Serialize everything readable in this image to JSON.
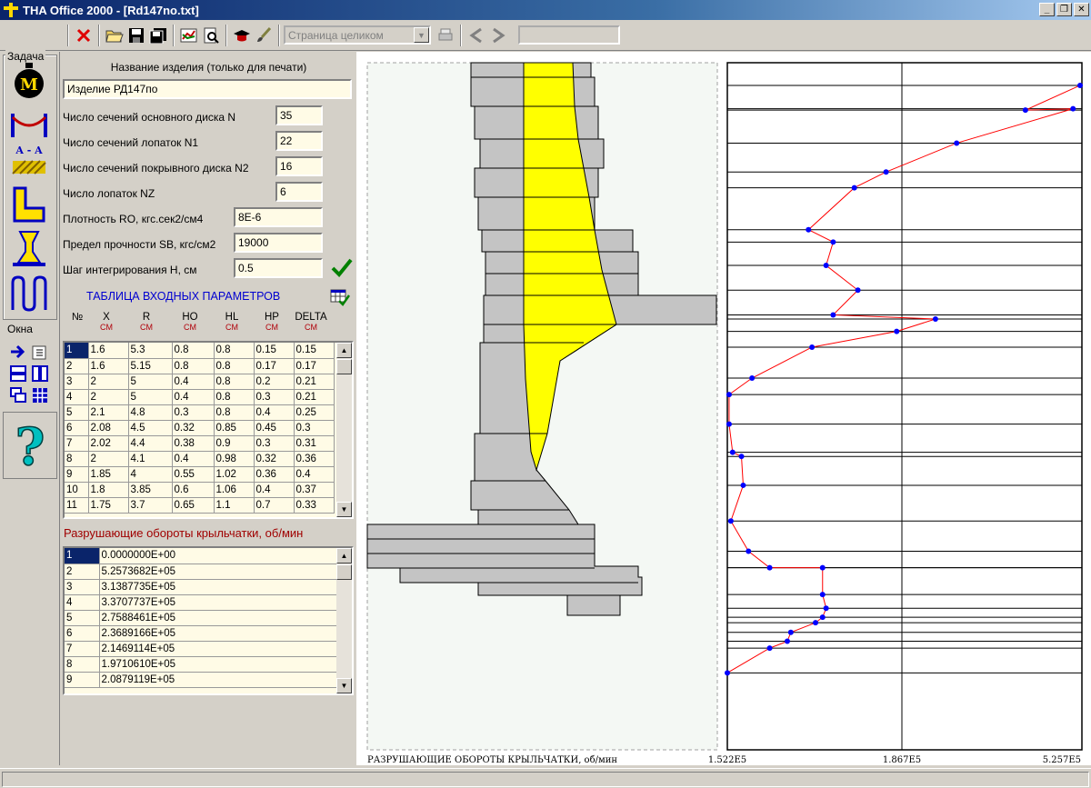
{
  "window": {
    "title": "THA Office 2000 - [Rd147no.txt]",
    "minimize_glyph": "_",
    "restore_glyph": "❐",
    "close_glyph": "✕"
  },
  "toolbar": {
    "page_mode": "Страница целиком"
  },
  "taskpanel": {
    "group_task": "Задача",
    "group_windows": "Окна",
    "section_label": "A - A",
    "mass_letter": "M",
    "help_glyph": "?"
  },
  "form": {
    "product_name_label": "Название изделия (только для печати)",
    "product_name_value": "Изделие РД147по",
    "fields": [
      {
        "label": "Число сечений основного диска  N",
        "value": "35"
      },
      {
        "label": "Число сечений лопаток  N1",
        "value": "22"
      },
      {
        "label": "Число сечений покрывного диска  N2",
        "value": "16"
      },
      {
        "label": "Число лопаток  NZ",
        "value": "6"
      },
      {
        "label": "Плотность  RO, кгс.сек2/см4",
        "value": "8E-6"
      },
      {
        "label": "Предел прочности SB,  кгс/см2",
        "value": "19000"
      },
      {
        "label": "Шаг интегрирования  H,  см",
        "value": "0.5"
      }
    ],
    "input_table_title": "ТАБЛИЦА  ВХОДНЫХ  ПАРАМЕТРОВ",
    "columns": [
      {
        "name": "№",
        "unit": ""
      },
      {
        "name": "X",
        "unit": "СМ"
      },
      {
        "name": "R",
        "unit": "СМ"
      },
      {
        "name": "HO",
        "unit": "СМ"
      },
      {
        "name": "HL",
        "unit": "СМ"
      },
      {
        "name": "HP",
        "unit": "СМ"
      },
      {
        "name": "DELTA",
        "unit": "СМ"
      }
    ],
    "rows": [
      [
        "1",
        "1.6",
        "5.3",
        "0.8",
        "0.8",
        "0.15",
        "0.15"
      ],
      [
        "2",
        "1.6",
        "5.15",
        "0.8",
        "0.8",
        "0.17",
        "0.17"
      ],
      [
        "3",
        "2",
        "5",
        "0.4",
        "0.8",
        "0.2",
        "0.21"
      ],
      [
        "4",
        "2",
        "5",
        "0.4",
        "0.8",
        "0.3",
        "0.21"
      ],
      [
        "5",
        "2.1",
        "4.8",
        "0.3",
        "0.8",
        "0.4",
        "0.25"
      ],
      [
        "6",
        "2.08",
        "4.5",
        "0.32",
        "0.85",
        "0.45",
        "0.3"
      ],
      [
        "7",
        "2.02",
        "4.4",
        "0.38",
        "0.9",
        "0.3",
        "0.31"
      ],
      [
        "8",
        "2",
        "4.1",
        "0.4",
        "0.98",
        "0.32",
        "0.36"
      ],
      [
        "9",
        "1.85",
        "4",
        "0.55",
        "1.02",
        "0.36",
        "0.4"
      ],
      [
        "10",
        "1.8",
        "3.85",
        "0.6",
        "1.06",
        "0.4",
        "0.37"
      ],
      [
        "11",
        "1.75",
        "3.7",
        "0.65",
        "1.1",
        "0.7",
        "0.33"
      ]
    ],
    "speed_title": "Разрушающие обороты крыльчатки,  об/мин",
    "speeds": [
      [
        "1",
        "0.0000000E+00"
      ],
      [
        "2",
        "5.2573682E+05"
      ],
      [
        "3",
        "3.1387735E+05"
      ],
      [
        "4",
        "3.3707737E+05"
      ],
      [
        "5",
        "2.7588461E+05"
      ],
      [
        "6",
        "2.3689166E+05"
      ],
      [
        "7",
        "2.1469114E+05"
      ],
      [
        "8",
        "1.9710610E+05"
      ],
      [
        "9",
        "2.0879119E+05"
      ]
    ]
  },
  "chart_data": {
    "type": "line",
    "title": "",
    "xlabel": "РАЗРУШАЮЩИЕ  ОБОРОТЫ  КРЫЛЬЧАТКИ, об/мин",
    "ylabel": "",
    "x_tick_labels": [
      "1.522E5",
      "1.867E5",
      "5.257E5"
    ],
    "grid": true,
    "series": [
      {
        "color": "#ff0000",
        "marker_color": "#0000ff",
        "points_frac": [
          [
            1.0,
            0.033
          ],
          [
            0.845,
            0.069
          ],
          [
            0.98,
            0.067
          ],
          [
            0.65,
            0.117
          ],
          [
            0.45,
            0.159
          ],
          [
            0.36,
            0.182
          ],
          [
            0.23,
            0.243
          ],
          [
            0.3,
            0.261
          ],
          [
            0.28,
            0.295
          ],
          [
            0.37,
            0.331
          ],
          [
            0.3,
            0.367
          ],
          [
            0.59,
            0.373
          ],
          [
            0.48,
            0.391
          ],
          [
            0.24,
            0.414
          ],
          [
            0.07,
            0.459
          ],
          [
            0.005,
            0.483
          ],
          [
            0.005,
            0.526
          ],
          [
            0.015,
            0.567
          ],
          [
            0.04,
            0.573
          ],
          [
            0.045,
            0.615
          ],
          [
            0.01,
            0.667
          ],
          [
            0.06,
            0.711
          ],
          [
            0.12,
            0.735
          ],
          [
            0.27,
            0.735
          ],
          [
            0.27,
            0.774
          ],
          [
            0.28,
            0.794
          ],
          [
            0.27,
            0.807
          ],
          [
            0.25,
            0.815
          ],
          [
            0.18,
            0.829
          ],
          [
            0.17,
            0.842
          ],
          [
            0.12,
            0.852
          ],
          [
            0.0,
            0.888
          ]
        ]
      }
    ]
  }
}
